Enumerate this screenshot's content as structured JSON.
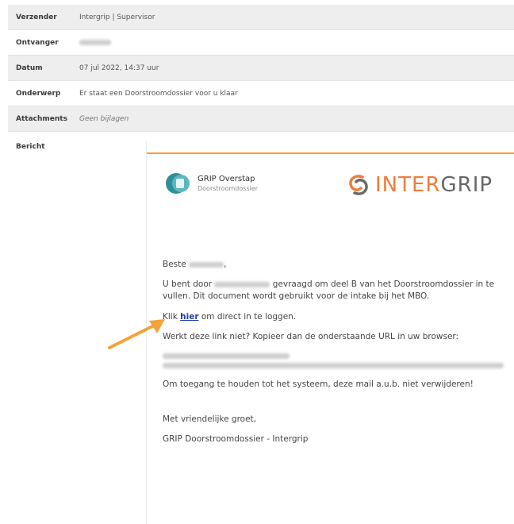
{
  "meta": {
    "sender_label": "Verzender",
    "sender_value": "Intergrip | Supervisor",
    "recipient_label": "Ontvanger",
    "date_label": "Datum",
    "date_value": "07 jul 2022, 14:37 uur",
    "subject_label": "Onderwerp",
    "subject_value": "Er staat een Doorstroomdossier voor u klaar",
    "attachments_label": "Attachments",
    "attachments_value": "Geen bijlagen",
    "message_label": "Bericht"
  },
  "logos": {
    "grip_title": "GRIP Overstap",
    "grip_subtitle": "Doorstroomdossier",
    "intergrip_brand_first": "INTER",
    "intergrip_brand_second": "GRIP"
  },
  "mail": {
    "greeting": "Beste",
    "line1_part1": "U bent door",
    "line1_part2": "gevraagd om deel B van het Doorstroomdossier in te vullen. Dit document wordt gebruikt voor de intake bij het MBO.",
    "click_prefix": "Klik",
    "click_link": "hier",
    "click_suffix": "om direct in te loggen.",
    "link_not_working": "Werkt deze link niet? Kopieer dan de onderstaande URL in uw browser:",
    "keep_mail": "Om toegang te houden tot het systeem, deze mail a.u.b. niet verwijderen!",
    "regards": "Met vriendelijke groet,",
    "signature": "GRIP Doorstroomdossier - Intergrip"
  },
  "colors": {
    "accent_orange": "#f4a23a",
    "link_blue": "#1f3fa8",
    "grip_teal": "#2e8f98"
  }
}
